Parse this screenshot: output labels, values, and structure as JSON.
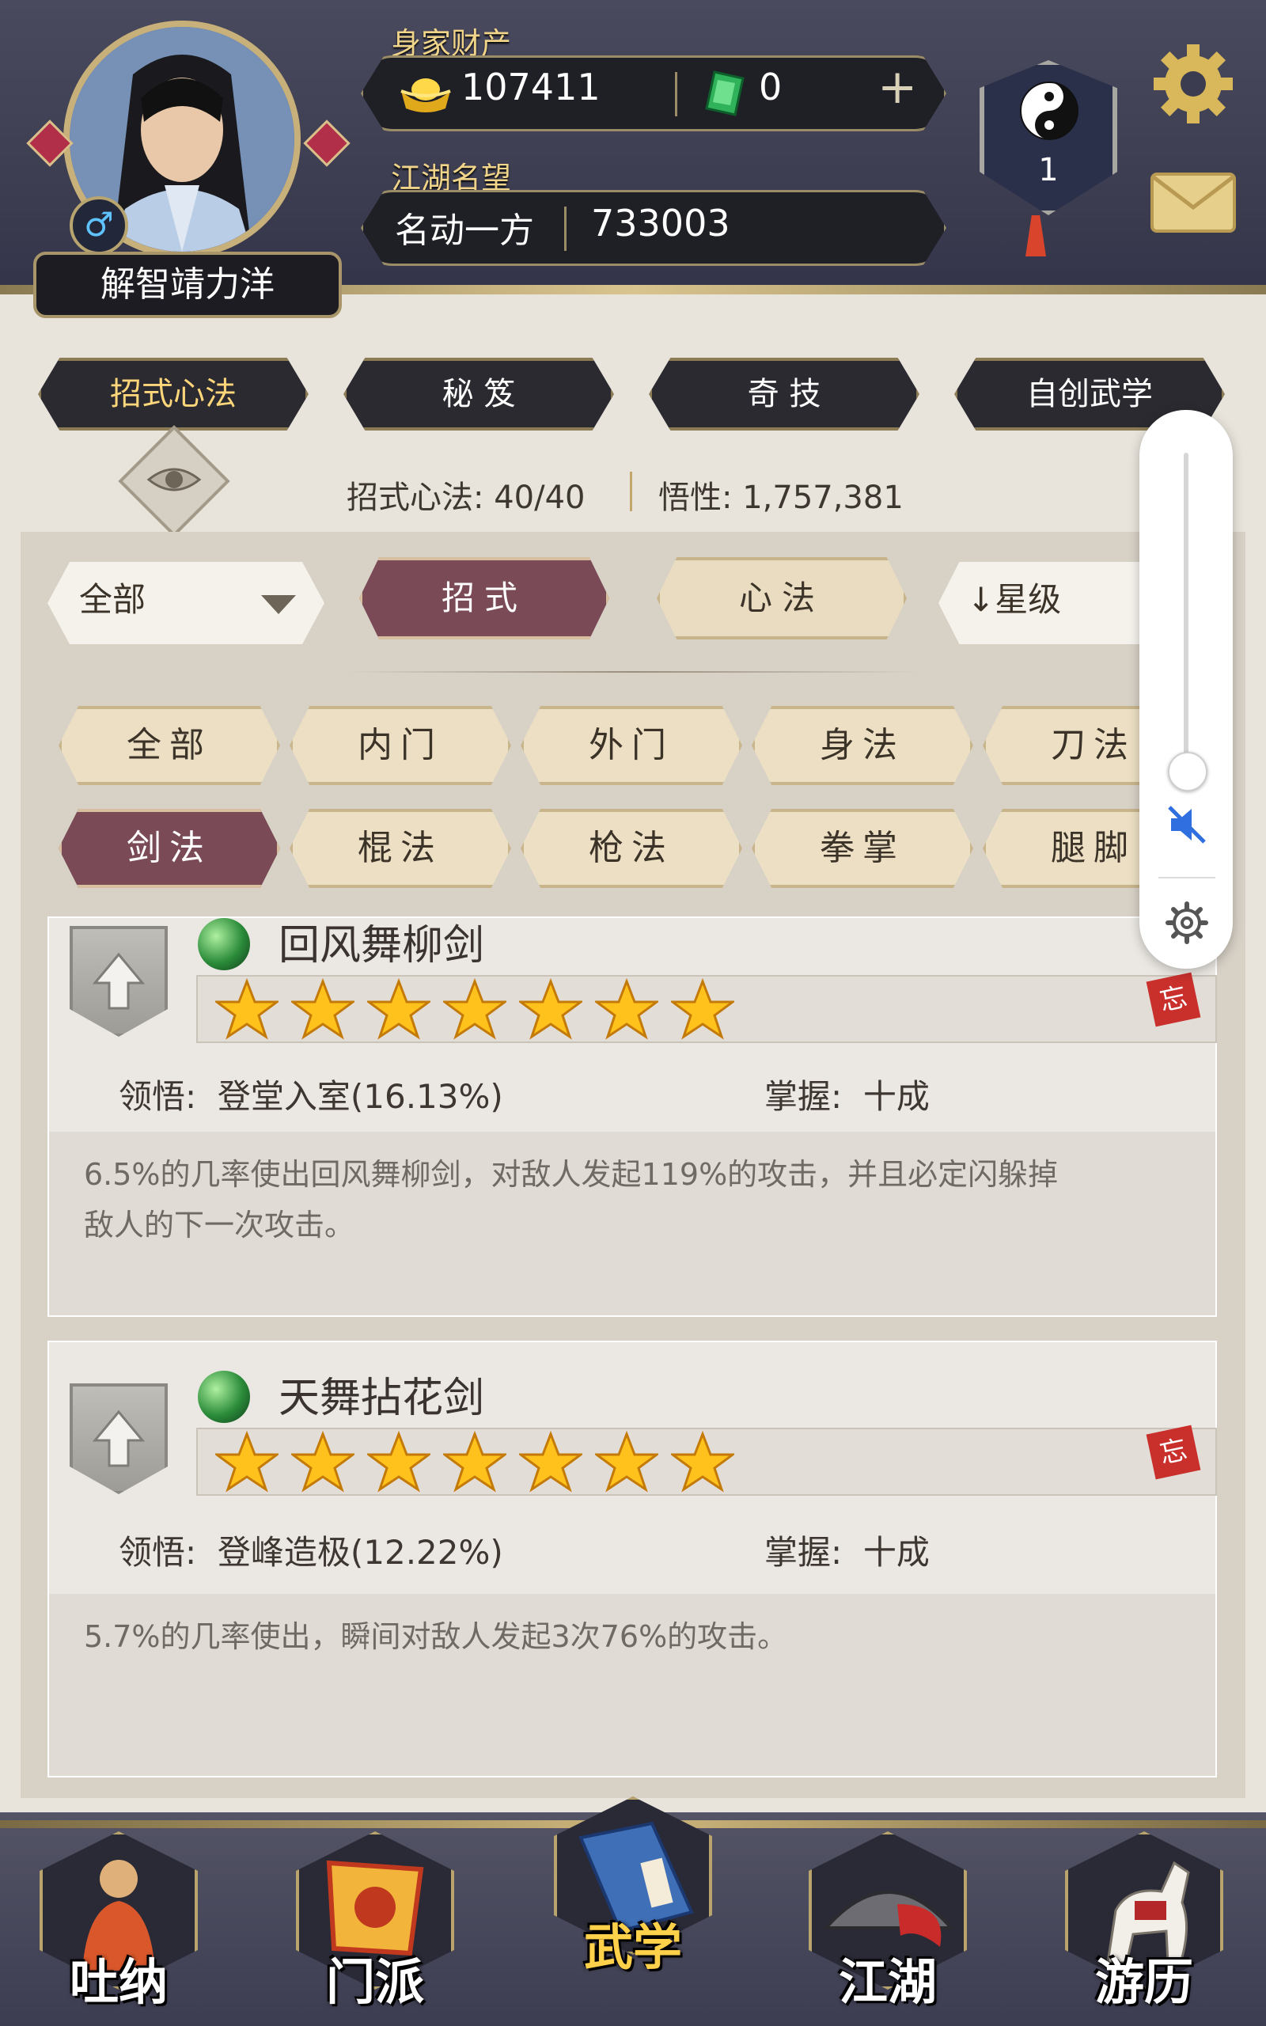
{
  "header": {
    "assets_label": "身家财产",
    "gold_value": "107411",
    "jade_value": "0",
    "add_symbol": "+",
    "reputation_label": "江湖名望",
    "reputation_title": "名动一方",
    "reputation_value": "733003",
    "player_name": "解智靖力洋",
    "gender_symbol": "♂",
    "rank_level": "1",
    "icons": [
      "gold-ingot-icon",
      "jade-icon",
      "add-icon",
      "yin-yang-icon",
      "settings-gear-icon",
      "mail-icon"
    ]
  },
  "tabs": {
    "items": [
      "招式心法",
      "秘 笈",
      "奇 技",
      "自创武学"
    ],
    "active_index": 0
  },
  "stats": {
    "skills_label": "招式心法",
    "skills_value": "40/40",
    "comprehension_label": "悟性",
    "comprehension_value": "1,757,381"
  },
  "filters": {
    "category_select": "全部",
    "type_moves": "招式",
    "type_heart": "心法",
    "sort_label": "星级",
    "sort_arrow": "↓"
  },
  "chips": {
    "row1": [
      "全部",
      "内门",
      "外门",
      "身法",
      "刀法"
    ],
    "row2": [
      "剑法",
      "棍法",
      "枪法",
      "拳掌",
      "腿脚"
    ],
    "active": "剑法"
  },
  "skills": [
    {
      "name": "回风舞柳剑",
      "stars": 7,
      "comprehension_label": "领悟",
      "comprehension": "登堂入室(16.13%)",
      "mastery_label": "掌握",
      "mastery": "十成",
      "forget_label": "忘",
      "description_line1": "6.5%的几率使出回风舞柳剑，对敌人发起119%的攻击，并且必定闪躲掉",
      "description_line2": "敌人的下一次攻击。"
    },
    {
      "name": "天舞拈花剑",
      "stars": 7,
      "comprehension_label": "领悟",
      "comprehension": "登峰造极(12.22%)",
      "mastery_label": "掌握",
      "mastery": "十成",
      "forget_label": "忘",
      "description_line1": "5.7%的几率使出，瞬间对敌人发起3次76%的攻击。",
      "description_line2": ""
    }
  ],
  "bottom_nav": {
    "items": [
      "吐纳",
      "门派",
      "武学",
      "江湖",
      "游历"
    ],
    "active": "武学"
  },
  "volume": {
    "level": 0,
    "muted": true,
    "icons": [
      "mute-icon",
      "settings-icon"
    ]
  },
  "colors": {
    "accent_dark": "#7b4a57",
    "gold_text": "#f0d48a",
    "header_bg": "#3c3c50"
  }
}
